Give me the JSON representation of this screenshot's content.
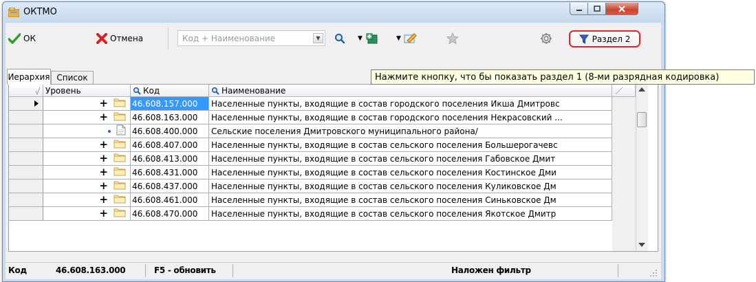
{
  "window": {
    "title": "ОКТМО"
  },
  "toolbar": {
    "ok_label": "ОК",
    "cancel_label": "Отмена",
    "search_placeholder": "Код + Наименование",
    "razdel_label": "Раздел 2"
  },
  "tabs": [
    {
      "label": "Иерархия",
      "active": true
    },
    {
      "label": "Список",
      "active": false
    }
  ],
  "grid": {
    "columns": [
      {
        "label": ""
      },
      {
        "label": "Уровень"
      },
      {
        "label": "Код"
      },
      {
        "label": "Наименование"
      }
    ],
    "rows": [
      {
        "level": "+",
        "icon": "folder-icon",
        "code": "46.608.157.000",
        "name": "Населенные пункты, входящие в состав городского поселения Икша Дмитровс",
        "selected": true,
        "current": true
      },
      {
        "level": "+",
        "icon": "folder-icon",
        "code": "46.608.163.000",
        "name": "Населенные пункты, входящие в состав городского поселения Некрасовский ..."
      },
      {
        "level": "•",
        "icon": "document-icon",
        "code": "46.608.400.000",
        "name": "Сельские поселения Дмитровского муниципального района/"
      },
      {
        "level": "+",
        "icon": "folder-icon",
        "code": "46.608.407.000",
        "name": "Населенные пункты, входящие в состав сельского поселения Большерогачевс"
      },
      {
        "level": "+",
        "icon": "folder-icon",
        "code": "46.608.413.000",
        "name": "Населенные пункты, входящие в состав сельского поселения Габовское Дмит"
      },
      {
        "level": "+",
        "icon": "folder-icon",
        "code": "46.608.431.000",
        "name": "Населенные пункты, входящие в состав сельского поселения Костинское Дми"
      },
      {
        "level": "+",
        "icon": "folder-icon",
        "code": "46.608.437.000",
        "name": "Населенные пункты, входящие в состав сельского поселения Куликовское Дм"
      },
      {
        "level": "+",
        "icon": "folder-icon",
        "code": "46.608.461.000",
        "name": "Населенные пункты, входящие в состав сельского поселения Синьковское Дм"
      },
      {
        "level": "+",
        "icon": "folder-icon",
        "code": "46.608.470.000",
        "name": "Населенные пункты, входящие в состав сельского поселения Якотское Дмитр"
      }
    ]
  },
  "status": {
    "code_label": "Код",
    "code_value": "46.608.163.000",
    "refresh_hint": "F5 - обновить",
    "filter_text": "Наложен фильтр"
  },
  "tooltip": {
    "text": "Нажмите кнопку, что бы показать раздел 1 (8-ми разрядная кодировка)"
  },
  "colors": {
    "selection": "#3399ff",
    "highlight_border": "#e0252b",
    "tooltip_bg": "#ffffe1"
  }
}
